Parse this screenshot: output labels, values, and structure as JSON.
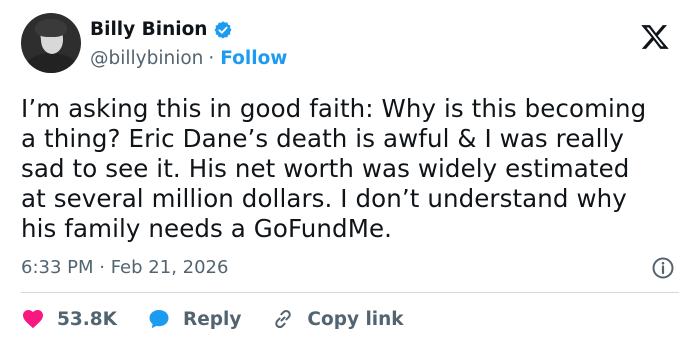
{
  "author": {
    "display_name": "Billy Binion",
    "handle": "@billybinion",
    "separator": "·",
    "follow_label": "Follow"
  },
  "tweet": {
    "lines": [
      "I’m asking this in good faith: Why is this becoming",
      "a thing? Eric Dane’s death is awful & I was really",
      "sad to see it. His net worth was widely estimated",
      "at several million dollars. I don’t understand why",
      "his family needs a GoFundMe."
    ],
    "timestamp": "6:33 PM · Feb 21, 2026"
  },
  "actions": {
    "likes": "53.8K",
    "reply_label": "Reply",
    "copy_link_label": "Copy link"
  },
  "colors": {
    "accent": "#1d9bf0",
    "like": "#f91880",
    "text": "#0f1419",
    "muted": "#536471"
  },
  "icons": {
    "verified": "verified-badge-icon",
    "logo": "x-logo-icon",
    "info": "info-icon",
    "like": "heart-icon",
    "reply": "speech-bubble-icon",
    "copy_link": "link-icon"
  }
}
